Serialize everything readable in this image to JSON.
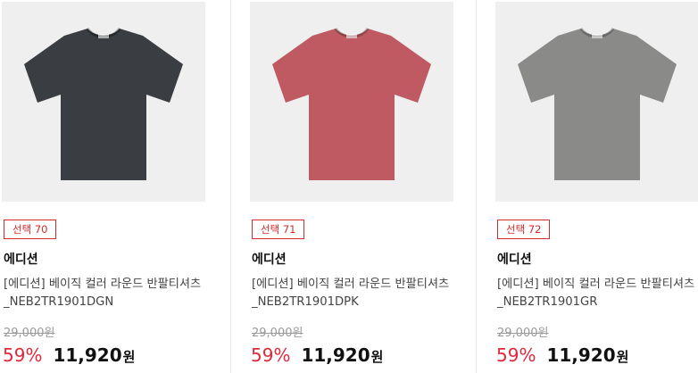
{
  "products": [
    {
      "badge": "선택 70",
      "brand": "에디션",
      "name": "[에디션] 베이직 컬러 라운드 반팔티셔츠_NEB2TR1901DGN",
      "original_price": "29,000원",
      "discount": "59%",
      "price": "11,920",
      "currency": "원",
      "shirt_color": "#3a3d42"
    },
    {
      "badge": "선택 71",
      "brand": "에디션",
      "name": "[에디션] 베이직 컬러 라운드 반팔티셔츠_NEB2TR1901DPK",
      "original_price": "29,000원",
      "discount": "59%",
      "price": "11,920",
      "currency": "원",
      "shirt_color": "#c05a62"
    },
    {
      "badge": "선택 72",
      "brand": "에디션",
      "name": "[에디션] 베이직 컬러 라운드 반팔티셔츠_NEB2TR1901GR",
      "original_price": "29,000원",
      "discount": "59%",
      "price": "11,920",
      "currency": "원",
      "shirt_color": "#8a8b89"
    }
  ],
  "colors": {
    "accent": "#e0283a",
    "badge_border": "#d62a2a",
    "thumb_bg": "#efefef"
  }
}
